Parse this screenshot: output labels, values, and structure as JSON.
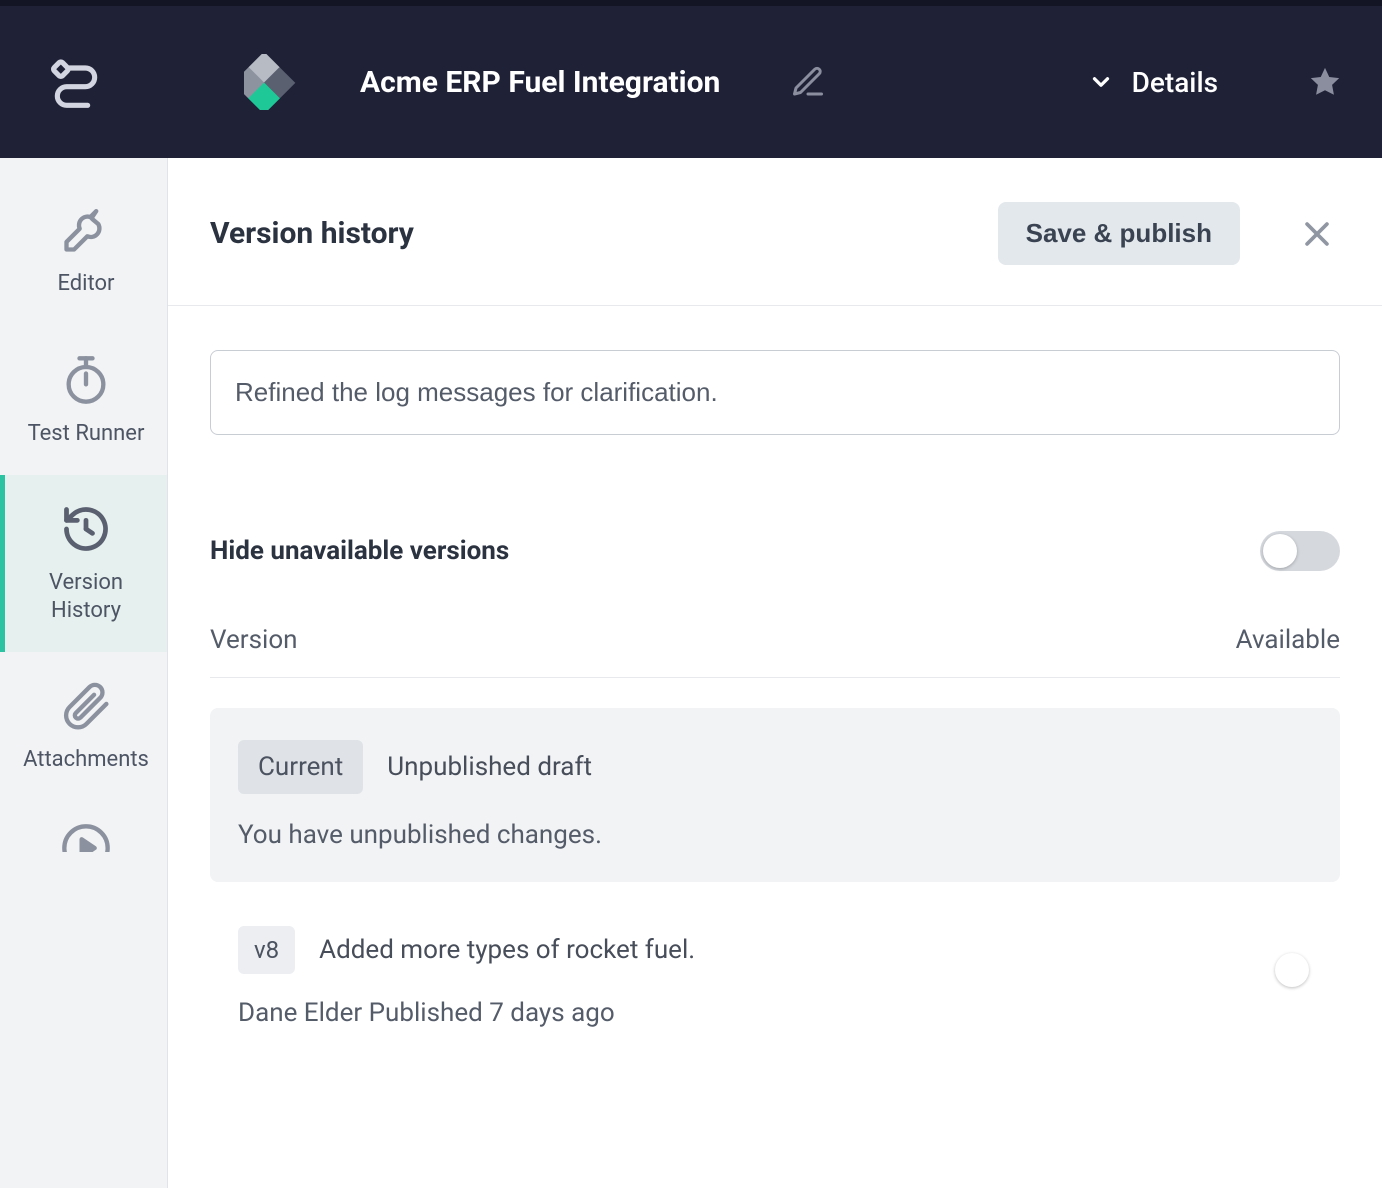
{
  "header": {
    "project_title": "Acme ERP Fuel Integration",
    "dropdown_label": "Details"
  },
  "sidebar": {
    "items": [
      {
        "label": "Editor"
      },
      {
        "label": "Test Runner"
      },
      {
        "label": "Version History"
      },
      {
        "label": "Attachments"
      }
    ]
  },
  "panel": {
    "title": "Version history",
    "save_button": "Save & publish",
    "description_value": "Refined the log messages for clarification.",
    "hide_label": "Hide unavailable versions",
    "columns": {
      "version": "Version",
      "available": "Available"
    }
  },
  "versions": [
    {
      "badge": "Current",
      "title": "Unpublished draft",
      "subtitle": "You have unpublished changes."
    },
    {
      "badge": "v8",
      "title": "Added more types of rocket fuel.",
      "meta": "Dane Elder Published 7 days ago",
      "available": true
    }
  ]
}
